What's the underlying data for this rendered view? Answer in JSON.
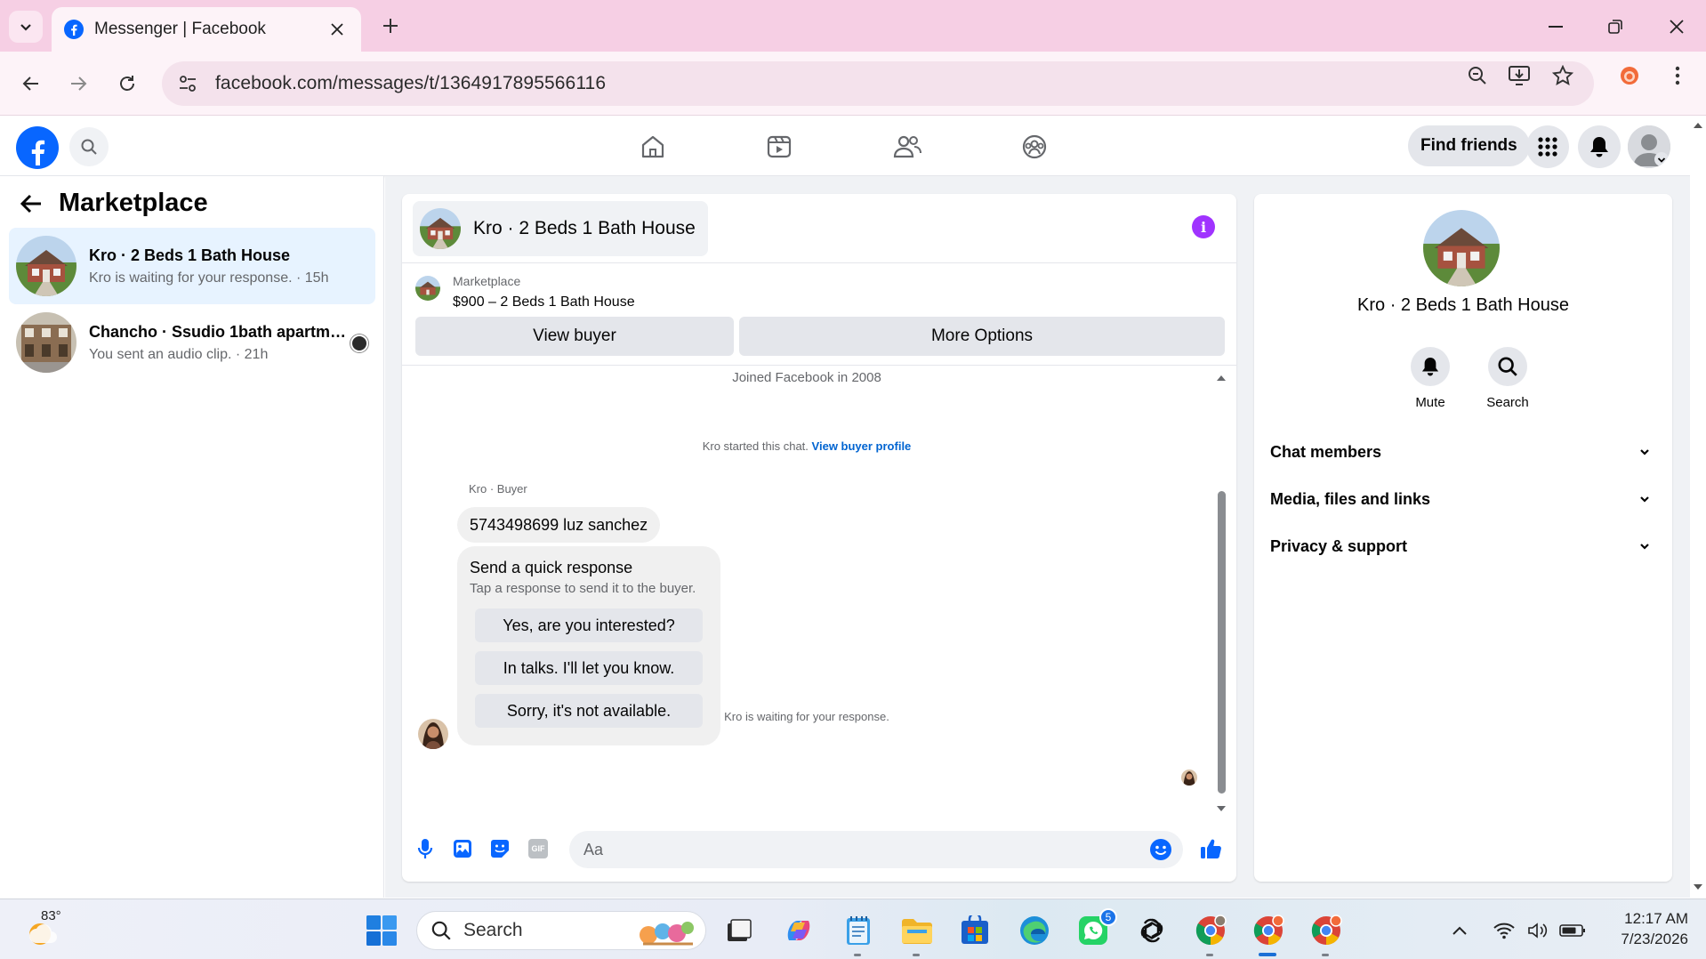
{
  "browser": {
    "tab_title": "Messenger | Facebook",
    "url": "facebook.com/messages/t/1364917895566116",
    "icons": [
      "chevron-down-icon",
      "facebook-favicon-icon",
      "close-icon",
      "plus-icon",
      "minimize-icon",
      "restore-icon",
      "close-window-icon",
      "back-icon",
      "forward-icon",
      "reload-icon",
      "site-settings-icon",
      "zoom-icon",
      "install-app-icon",
      "bookmark-star-icon",
      "extension-icon",
      "kebab-menu-icon"
    ]
  },
  "fb_header": {
    "find_friends_label": "Find friends",
    "nav_icons": [
      "home-icon",
      "video-icon",
      "friends-icon",
      "groups-icon"
    ]
  },
  "left": {
    "title": "Marketplace",
    "conversations": [
      {
        "name": "Kro · 2 Beds 1 Bath House",
        "preview": "Kro is waiting for your response. · 15h"
      },
      {
        "name": "Chancho · Ssudio 1bath apartme...",
        "preview": "You sent an audio clip. · 21h"
      }
    ]
  },
  "chat": {
    "title": "Kro · 2 Beds 1 Bath House",
    "listing_label": "Marketplace",
    "listing_price": "$900 – 2 Beds 1 Bath House",
    "view_buyer_label": "View buyer",
    "more_options_label": "More Options",
    "joined_text": "Joined Facebook in 2008",
    "started_text": "Kro started this chat.",
    "view_profile_link": "View buyer profile",
    "sender_label": "Kro · Buyer",
    "message_text": "5743498699 luz sanchez",
    "quick_title": "Send a quick response",
    "quick_sub": "Tap a response to send it to the buyer.",
    "quick_options": [
      "Yes, are you interested?",
      "In talks. I'll let you know.",
      "Sorry, it's not available."
    ],
    "waiting_text": "Kro is waiting for your response.",
    "composer_placeholder": "Aa",
    "gif_label": "GIF"
  },
  "details": {
    "name": "Kro · 2 Beds 1 Bath House",
    "mute_label": "Mute",
    "search_label": "Search",
    "sections": [
      "Chat members",
      "Media, files and links",
      "Privacy & support"
    ]
  },
  "taskbar": {
    "temperature": "83°",
    "search_label": "Search",
    "whatsapp_badge": "5",
    "time": "12:17 AM",
    "date": "7/23/2026"
  },
  "colors": {
    "tab_bar": "#f6cfe4",
    "facebook_blue": "#0866ff",
    "messenger_purple": "#a033ff",
    "link_blue": "#0064d1",
    "selected_conversation": "#e7f3ff"
  }
}
